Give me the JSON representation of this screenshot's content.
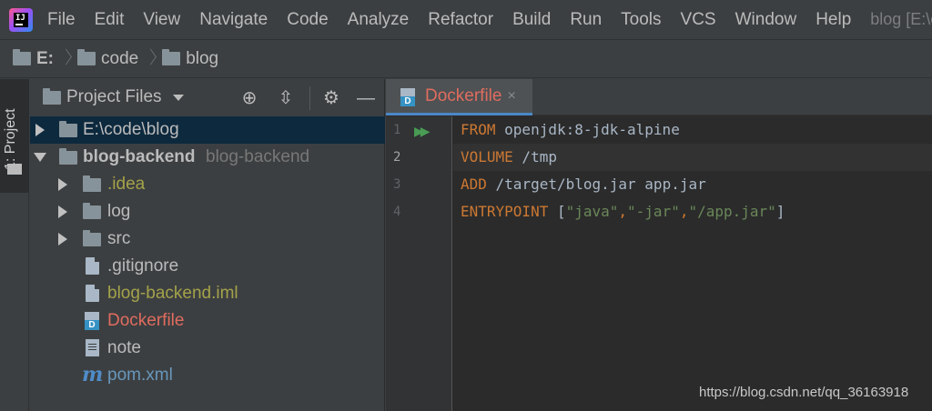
{
  "app": {
    "logo_text": "IJ",
    "window_title": "blog [E:\\co"
  },
  "menu": [
    "File",
    "Edit",
    "View",
    "Navigate",
    "Code",
    "Analyze",
    "Refactor",
    "Build",
    "Run",
    "Tools",
    "VCS",
    "Window",
    "Help"
  ],
  "breadcrumb": [
    "E:",
    "code",
    "blog"
  ],
  "tool_window": {
    "tab_label": "1: Project"
  },
  "project_panel": {
    "title": "Project Files",
    "tree": [
      {
        "label": "E:\\code\\blog",
        "type": "folder",
        "expanded": false,
        "selected": true
      },
      {
        "label": "blog-backend",
        "secondary": "blog-backend",
        "type": "module",
        "expanded": true
      },
      {
        "label": ".idea",
        "type": "folder",
        "expanded": false,
        "color": "#a4a24a"
      },
      {
        "label": "log",
        "type": "folder",
        "expanded": false
      },
      {
        "label": "src",
        "type": "folder",
        "expanded": false
      },
      {
        "label": ".gitignore",
        "type": "file"
      },
      {
        "label": "blog-backend.iml",
        "type": "file",
        "color": "#a4a24a"
      },
      {
        "label": "Dockerfile",
        "type": "docker",
        "color": "#e06c5f"
      },
      {
        "label": "note",
        "type": "text"
      },
      {
        "label": "pom.xml",
        "type": "maven",
        "color": "#6897bb"
      }
    ]
  },
  "editor": {
    "tab": {
      "title": "Dockerfile",
      "close": "×"
    },
    "line_numbers": [
      "1",
      "2",
      "3",
      "4"
    ],
    "current_line": 2,
    "code": [
      {
        "kw": "FROM",
        "rest": " openjdk:8-jdk-alpine"
      },
      {
        "kw": "VOLUME",
        "rest": " /tmp"
      },
      {
        "kw": "ADD",
        "rest": " /target/blog.jar app.jar"
      },
      {
        "kw": "ENTRYPOINT",
        "rest": " [",
        "s1": "\"java\"",
        "c1": ",",
        "s2": "\"-jar\"",
        "c2": ",",
        "s3": "\"/app.jar\"",
        "end": "]"
      }
    ]
  },
  "watermark": "https://blog.csdn.net/qq_36163918"
}
